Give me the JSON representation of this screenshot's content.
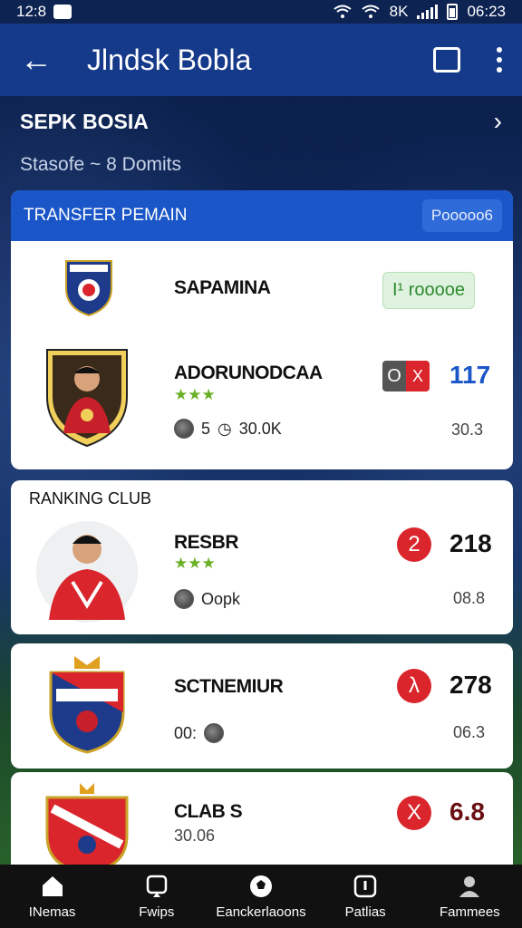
{
  "status": {
    "left_time": "12:8",
    "right_time": "06:23",
    "signal_text": "8K"
  },
  "appbar": {
    "back": "←",
    "title": "Jlndsk Bobla"
  },
  "section": {
    "title": "SEPK BOSIA",
    "chevron": "›",
    "subtitle": "Stasofe ~ 8 Domits"
  },
  "transfer": {
    "header": "TRANSFER PEMAIN",
    "header_button": "Pooooo6",
    "row1": {
      "name": "SAPAMINA",
      "tag": "I¹ rooooe"
    },
    "row2": {
      "name": "ADORUNODCAA",
      "stars": "★★★",
      "meta_count": "5",
      "meta_value": "30.0K",
      "badge_o": "O",
      "badge_x": "X",
      "value": "117",
      "sub": "30.3"
    }
  },
  "ranking": {
    "header": "RANKING CLUB",
    "row1": {
      "name": "RESBR",
      "stars": "★★★",
      "meta": "Oopk",
      "rank": "2",
      "value": "218",
      "sub": "08.8"
    }
  },
  "club_row2": {
    "name": "SCTNEMIUR",
    "meta": "00:",
    "rank": "λ",
    "value": "278",
    "sub": "06.3"
  },
  "club_row3": {
    "name": "CLAB S",
    "sub_name": "30.06",
    "rank": "X",
    "value": "6.8"
  },
  "nav": [
    {
      "label": "INemas",
      "icon": "home-icon"
    },
    {
      "label": "Fwips",
      "icon": "search-icon"
    },
    {
      "label": "Eanckerlaoons",
      "icon": "soccer-ball-icon"
    },
    {
      "label": "Patlias",
      "icon": "info-icon"
    },
    {
      "label": "Fammees",
      "icon": "profile-icon"
    }
  ],
  "colors": {
    "primary": "#163a8a",
    "accent": "#1a56c7",
    "red": "#d9252b",
    "green": "#2e8b2e"
  }
}
